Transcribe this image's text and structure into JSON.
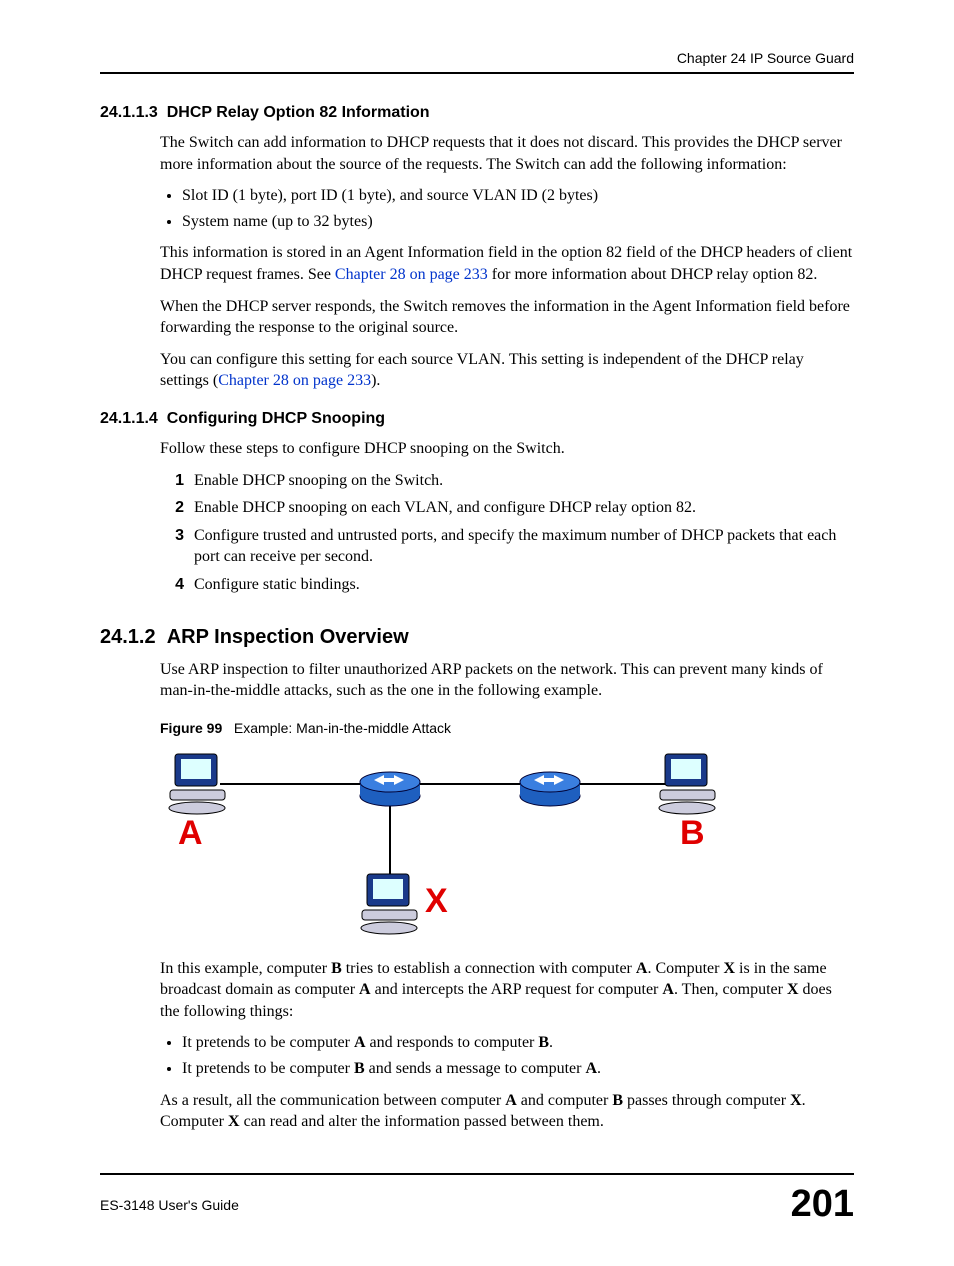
{
  "header": {
    "chapter": "Chapter 24 IP Source Guard"
  },
  "sec1": {
    "num": "24.1.1.3",
    "title": "DHCP Relay Option 82 Information",
    "p1": "The Switch can add information to DHCP requests that it does not discard. This provides the DHCP server more information about the source of the requests. The Switch can add the following information:",
    "b1": "Slot ID (1 byte), port ID (1 byte), and source VLAN ID (2 bytes)",
    "b2": "System name (up to 32 bytes)",
    "p2a": "This information is stored in an Agent Information field in the option 82 field of the DHCP headers of client DHCP request frames. See ",
    "p2link": "Chapter 28 on page 233",
    "p2b": " for more information about DHCP relay option 82.",
    "p3": "When the DHCP server responds, the Switch removes the information in the Agent Information field before forwarding the response to the original source.",
    "p4a": "You can configure this setting for each source VLAN. This setting is independent of the DHCP relay settings (",
    "p4link": "Chapter 28 on page 233",
    "p4b": ")."
  },
  "sec2": {
    "num": "24.1.1.4",
    "title": "Configuring DHCP Snooping",
    "p1": "Follow these steps to configure DHCP snooping on the Switch.",
    "s1": "Enable DHCP snooping on the Switch.",
    "s2": "Enable DHCP snooping on each VLAN, and configure DHCP relay option 82.",
    "s3": "Configure trusted and untrusted ports, and specify the maximum number of DHCP packets that each port can receive per second.",
    "s4": "Configure static bindings."
  },
  "sec3": {
    "num": "24.1.2",
    "title": "ARP Inspection Overview",
    "p1": "Use ARP inspection to filter unauthorized ARP packets on the network. This can prevent many kinds of man-in-the-middle attacks, such as the one in the following example.",
    "fignum": "Figure 99",
    "figcap": "Example: Man-in-the-middle Attack",
    "labelA": "A",
    "labelB": "B",
    "labelX": "X",
    "p2": "In this example, computer B tries to establish a connection with computer A. Computer X is in the same broadcast domain as computer A and intercepts the ARP request for computer A. Then, computer X does the following things:",
    "b1": "It pretends to be computer A and responds to computer B.",
    "b2": "It pretends to be computer B and sends a message to computer A.",
    "p3": "As a result, all the communication between computer A and computer B passes through computer X. Computer X can read and alter the information passed between them."
  },
  "footer": {
    "guide": "ES-3148 User's Guide",
    "page": "201"
  }
}
